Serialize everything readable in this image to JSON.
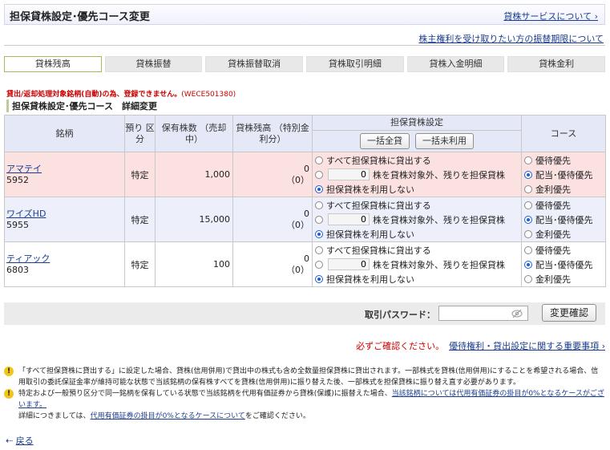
{
  "header": {
    "title": "担保貸株設定･優先コース変更",
    "link": "貸株サービスについて"
  },
  "top_link": "株主権利を受け取りたい方の振替期限について",
  "tabs": [
    {
      "label": "貸株残高",
      "active": true
    },
    {
      "label": "貸株振替",
      "active": false
    },
    {
      "label": "貸株振替取消",
      "active": false
    },
    {
      "label": "貸株取引明細",
      "active": false
    },
    {
      "label": "貸株入金明細",
      "active": false
    },
    {
      "label": "貸株金利",
      "active": false
    }
  ],
  "error": {
    "message": "貸出/返却処理対象銘柄(自動)の為、登録できません。",
    "code": "(WECE501380)"
  },
  "section_title": "担保貸株設定･優先コース　詳細変更",
  "table": {
    "headers": {
      "name": "銘柄",
      "account": "預り 区分",
      "holding": "保有株数 （売却中）",
      "lend": "貸株残高 （特別金利分）",
      "collateral": "担保貸株設定",
      "bulk_all": "一括全貸",
      "bulk_none": "一括未利用",
      "course": "コース"
    },
    "options": {
      "lend_all": "すべて担保貸株に貸出する",
      "partial": "株を貸株対象外、残りを担保貸株",
      "none": "担保貸株を利用しない"
    },
    "courses": [
      "優待優先",
      "配当･優待優先",
      "金利優先"
    ],
    "rows": [
      {
        "name": "アマテイ",
        "code": "5952",
        "account": "特定",
        "holding": "1,000",
        "lend": "0",
        "lend_special": "（0）",
        "qty": "0",
        "collateral_selected": 2,
        "course_selected": 1
      },
      {
        "name": "ワイズHD",
        "code": "5955",
        "account": "特定",
        "holding": "15,000",
        "lend": "0",
        "lend_special": "（0）",
        "qty": "0",
        "collateral_selected": 2,
        "course_selected": 1
      },
      {
        "name": "ティアック",
        "code": "6803",
        "account": "特定",
        "holding": "100",
        "lend": "0",
        "lend_special": "（0）",
        "qty": "0",
        "collateral_selected": 2,
        "course_selected": 1
      }
    ]
  },
  "password": {
    "label": "取引パスワード：",
    "confirm_label": "変更確認"
  },
  "notice": {
    "red": "必ずご確認ください。",
    "link": "優待権利・貸出設定に関する重要事項"
  },
  "notes": {
    "note1": "「すべて担保貸株に貸出する」に設定した場合、貸株(信用併用)で貸出中の株式も含め全数量担保貸株に貸出されます。一部株式を貸株(信用併用)にすることを希望される場合、信用取引の委託保証金率が維持可能な状態で当該銘柄の保有株すべてを貸株(信用併用)に振り替えた後、一部株式を担保貸株に振り替え直す必要があります。",
    "note2_pre": "特定および一般預り区分で同一銘柄を保有している状態で当該銘柄を代用有価証券から貸株(保護)に振替えた場合、",
    "note2_link": "当該銘柄については代用有価証券の掛目が0%となるケースがございます。",
    "note3_pre": "詳細につきましては、",
    "note3_link": "代用有価証券の掛目が0%となるケースについて",
    "note3_post": "をご確認ください。"
  },
  "back_label": "戻る"
}
